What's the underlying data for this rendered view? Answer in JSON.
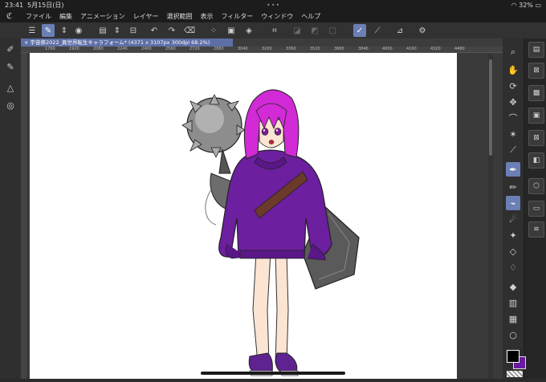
{
  "status_bar": {
    "time": "23:41",
    "date": "5月15日(日)",
    "battery": "32%"
  },
  "menu": [
    "ファイル",
    "編集",
    "アニメーション",
    "レイヤー",
    "選択範囲",
    "表示",
    "フィルター",
    "ウィンドウ",
    "ヘルプ"
  ],
  "document_tab": "宇宙祭2022_異世界転生キャラフォーム* (4371 x 3107px 300dpi 68.2%)",
  "ruler_ticks": [
    "1760",
    "1840",
    "1920",
    "2000",
    "2080",
    "2160",
    "2240",
    "2320",
    "2400",
    "2480",
    "2560",
    "2640",
    "2720",
    "2800",
    "2880",
    "2960",
    "3040",
    "3120",
    "3200",
    "3280",
    "3360",
    "3440",
    "3520",
    "3600",
    "3680",
    "3760",
    "3840",
    "3920",
    "4000",
    "4080",
    "4160",
    "4240",
    "4320",
    "4400",
    "4480"
  ],
  "colors": {
    "main": "#000000",
    "sub": "#6a1aa0",
    "accent": "#6b7fb5"
  },
  "tools_left": [
    "brush-settings-icon",
    "brush-pen-icon",
    "ruler-icon",
    "color-circle-icon"
  ],
  "tools_right": [
    "zoom-icon",
    "hand-icon",
    "rotate-icon",
    "move-icon",
    "lasso-icon",
    "magic-wand-icon",
    "eyedropper-icon",
    "pen-icon",
    "pencil-icon",
    "brush-icon",
    "airbrush-icon",
    "decoration-icon",
    "eraser-icon",
    "blend-icon",
    "fill-icon",
    "gradient-icon",
    "frame-icon",
    "shape-icon"
  ]
}
